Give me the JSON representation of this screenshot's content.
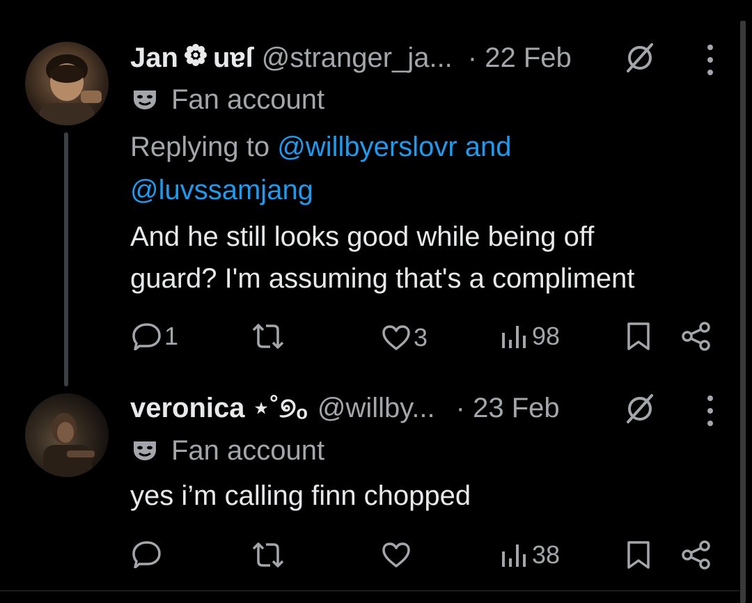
{
  "tweets": [
    {
      "name": "Jan",
      "name_suffix": "uɐſ",
      "handle": "@stranger_ja...",
      "date": "· 22 Feb",
      "label": "Fan account",
      "reply_prefix": "Replying to",
      "reply_user1": "@willbyerslovr",
      "reply_and": "and",
      "reply_user2": "@luvssamjang",
      "text_line1": "And he still looks good while being off",
      "text_line2": "guard? I'm assuming that's a compliment",
      "replies": "1",
      "retweets": "",
      "likes": "3",
      "views": "98"
    },
    {
      "name": "veronica ⋆˚୭ₒ",
      "handle": "@willby...",
      "date": "· 23 Feb",
      "label": "Fan account",
      "text_line1": "yes i’m calling finn chopped",
      "replies": "",
      "retweets": "",
      "likes": "",
      "views": "38"
    }
  ],
  "icons": {
    "more": "more-vertical-icon",
    "reply": "reply-icon",
    "retweet": "retweet-icon",
    "like": "heart-icon",
    "views": "views-icon",
    "bookmark": "bookmark-icon",
    "share": "share-icon",
    "label": "masks-icon",
    "verified": "verified-icon"
  },
  "colors": {
    "background": "#000000",
    "text": "#e7e9ea",
    "secondary": "#a3a7ab",
    "link": "#1d9bf0"
  }
}
